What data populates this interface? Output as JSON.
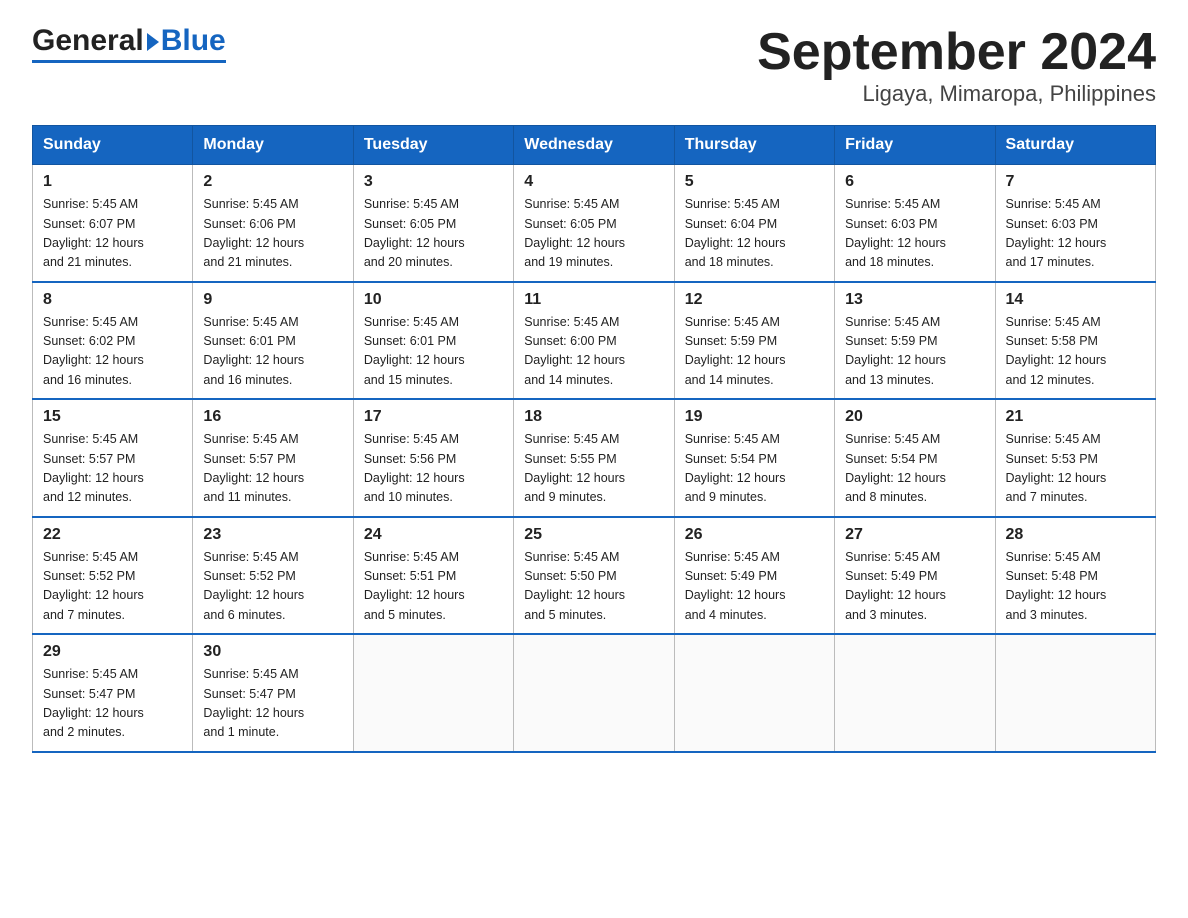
{
  "header": {
    "logo_general": "General",
    "logo_blue": "Blue",
    "title": "September 2024",
    "subtitle": "Ligaya, Mimaropa, Philippines"
  },
  "calendar": {
    "days_of_week": [
      "Sunday",
      "Monday",
      "Tuesday",
      "Wednesday",
      "Thursday",
      "Friday",
      "Saturday"
    ],
    "weeks": [
      [
        {
          "day": "1",
          "sunrise": "5:45 AM",
          "sunset": "6:07 PM",
          "daylight": "12 hours and 21 minutes."
        },
        {
          "day": "2",
          "sunrise": "5:45 AM",
          "sunset": "6:06 PM",
          "daylight": "12 hours and 21 minutes."
        },
        {
          "day": "3",
          "sunrise": "5:45 AM",
          "sunset": "6:05 PM",
          "daylight": "12 hours and 20 minutes."
        },
        {
          "day": "4",
          "sunrise": "5:45 AM",
          "sunset": "6:05 PM",
          "daylight": "12 hours and 19 minutes."
        },
        {
          "day": "5",
          "sunrise": "5:45 AM",
          "sunset": "6:04 PM",
          "daylight": "12 hours and 18 minutes."
        },
        {
          "day": "6",
          "sunrise": "5:45 AM",
          "sunset": "6:03 PM",
          "daylight": "12 hours and 18 minutes."
        },
        {
          "day": "7",
          "sunrise": "5:45 AM",
          "sunset": "6:03 PM",
          "daylight": "12 hours and 17 minutes."
        }
      ],
      [
        {
          "day": "8",
          "sunrise": "5:45 AM",
          "sunset": "6:02 PM",
          "daylight": "12 hours and 16 minutes."
        },
        {
          "day": "9",
          "sunrise": "5:45 AM",
          "sunset": "6:01 PM",
          "daylight": "12 hours and 16 minutes."
        },
        {
          "day": "10",
          "sunrise": "5:45 AM",
          "sunset": "6:01 PM",
          "daylight": "12 hours and 15 minutes."
        },
        {
          "day": "11",
          "sunrise": "5:45 AM",
          "sunset": "6:00 PM",
          "daylight": "12 hours and 14 minutes."
        },
        {
          "day": "12",
          "sunrise": "5:45 AM",
          "sunset": "5:59 PM",
          "daylight": "12 hours and 14 minutes."
        },
        {
          "day": "13",
          "sunrise": "5:45 AM",
          "sunset": "5:59 PM",
          "daylight": "12 hours and 13 minutes."
        },
        {
          "day": "14",
          "sunrise": "5:45 AM",
          "sunset": "5:58 PM",
          "daylight": "12 hours and 12 minutes."
        }
      ],
      [
        {
          "day": "15",
          "sunrise": "5:45 AM",
          "sunset": "5:57 PM",
          "daylight": "12 hours and 12 minutes."
        },
        {
          "day": "16",
          "sunrise": "5:45 AM",
          "sunset": "5:57 PM",
          "daylight": "12 hours and 11 minutes."
        },
        {
          "day": "17",
          "sunrise": "5:45 AM",
          "sunset": "5:56 PM",
          "daylight": "12 hours and 10 minutes."
        },
        {
          "day": "18",
          "sunrise": "5:45 AM",
          "sunset": "5:55 PM",
          "daylight": "12 hours and 9 minutes."
        },
        {
          "day": "19",
          "sunrise": "5:45 AM",
          "sunset": "5:54 PM",
          "daylight": "12 hours and 9 minutes."
        },
        {
          "day": "20",
          "sunrise": "5:45 AM",
          "sunset": "5:54 PM",
          "daylight": "12 hours and 8 minutes."
        },
        {
          "day": "21",
          "sunrise": "5:45 AM",
          "sunset": "5:53 PM",
          "daylight": "12 hours and 7 minutes."
        }
      ],
      [
        {
          "day": "22",
          "sunrise": "5:45 AM",
          "sunset": "5:52 PM",
          "daylight": "12 hours and 7 minutes."
        },
        {
          "day": "23",
          "sunrise": "5:45 AM",
          "sunset": "5:52 PM",
          "daylight": "12 hours and 6 minutes."
        },
        {
          "day": "24",
          "sunrise": "5:45 AM",
          "sunset": "5:51 PM",
          "daylight": "12 hours and 5 minutes."
        },
        {
          "day": "25",
          "sunrise": "5:45 AM",
          "sunset": "5:50 PM",
          "daylight": "12 hours and 5 minutes."
        },
        {
          "day": "26",
          "sunrise": "5:45 AM",
          "sunset": "5:49 PM",
          "daylight": "12 hours and 4 minutes."
        },
        {
          "day": "27",
          "sunrise": "5:45 AM",
          "sunset": "5:49 PM",
          "daylight": "12 hours and 3 minutes."
        },
        {
          "day": "28",
          "sunrise": "5:45 AM",
          "sunset": "5:48 PM",
          "daylight": "12 hours and 3 minutes."
        }
      ],
      [
        {
          "day": "29",
          "sunrise": "5:45 AM",
          "sunset": "5:47 PM",
          "daylight": "12 hours and 2 minutes."
        },
        {
          "day": "30",
          "sunrise": "5:45 AM",
          "sunset": "5:47 PM",
          "daylight": "12 hours and 1 minute."
        },
        null,
        null,
        null,
        null,
        null
      ]
    ],
    "labels": {
      "sunrise": "Sunrise:",
      "sunset": "Sunset:",
      "daylight": "Daylight:"
    }
  }
}
